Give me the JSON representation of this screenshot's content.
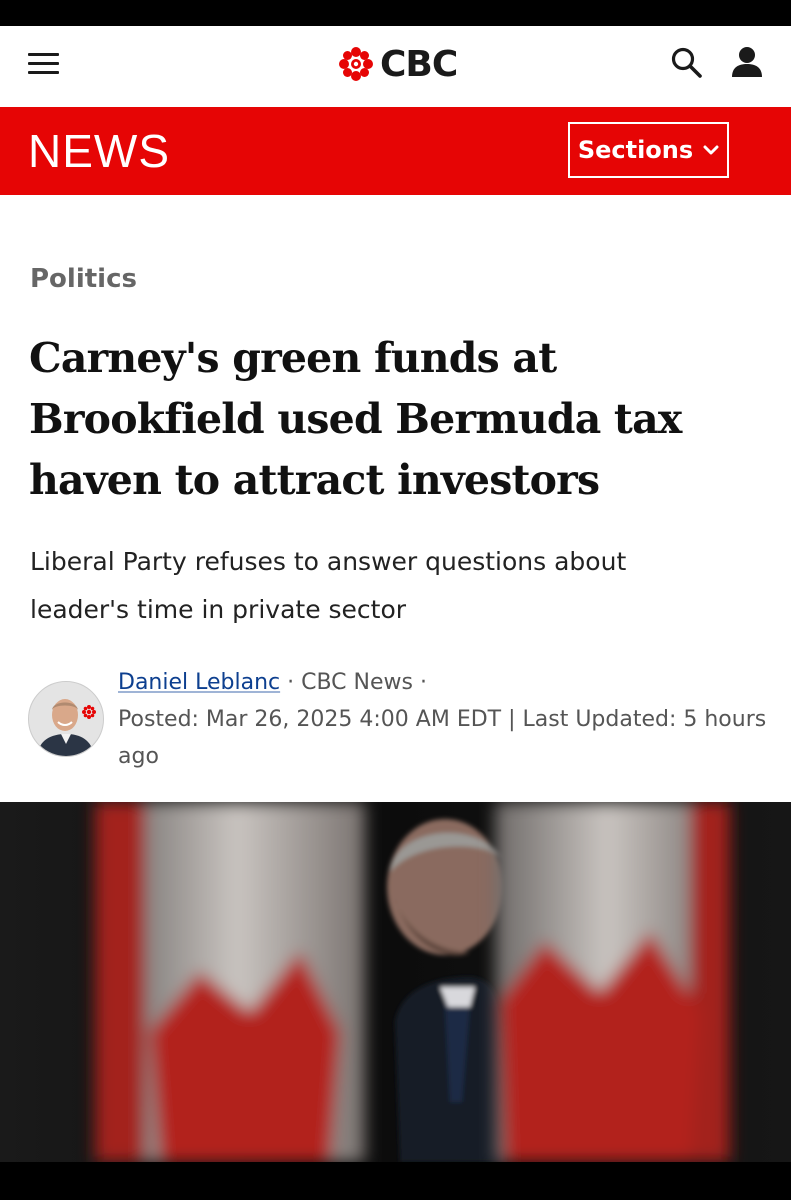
{
  "header": {
    "logo_text": "CBC",
    "menu_icon": "hamburger-menu-icon",
    "search_icon": "search-icon",
    "account_icon": "user-account-icon"
  },
  "news_bar": {
    "title": "NEWS",
    "sections_label": "Sections",
    "accent_color": "#e60505"
  },
  "article": {
    "category": "Politics",
    "headline": "Carney's green funds at Brookfield used Bermuda tax haven to attract investors",
    "dek": "Liberal Party refuses to answer questions about leader's time in private sector",
    "byline": {
      "author": "Daniel Leblanc",
      "separator": " · ",
      "outlet": "CBC News",
      "dateline": "Posted: Mar 26, 2025 4:00 AM EDT | Last Updated: 5 hours ago"
    }
  }
}
